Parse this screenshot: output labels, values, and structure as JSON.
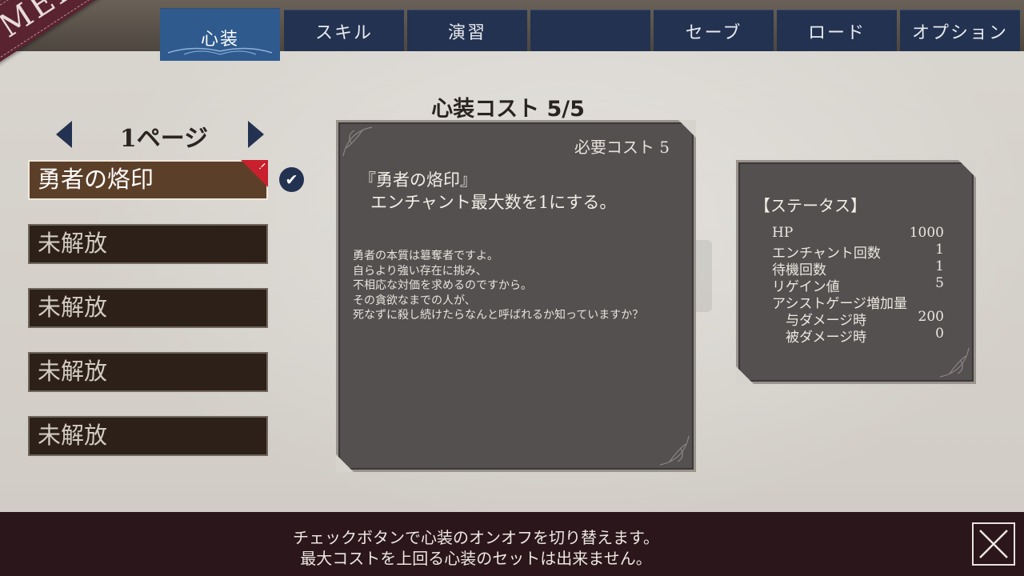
{
  "menu_label": "MENU",
  "tabs": [
    {
      "label": "心装",
      "active": true
    },
    {
      "label": "スキル"
    },
    {
      "label": "演習"
    },
    {
      "label": ""
    },
    {
      "label": "セーブ"
    },
    {
      "label": "ロード"
    },
    {
      "label": "オプション"
    }
  ],
  "page_nav": {
    "label": "1ページ"
  },
  "slots": [
    {
      "label": "勇者の烙印",
      "selected": true,
      "new_mark": "!"
    },
    {
      "label": "未解放"
    },
    {
      "label": "未解放"
    },
    {
      "label": "未解放"
    },
    {
      "label": "未解放"
    }
  ],
  "cost_title": "心装コスト 5/5",
  "description": {
    "required_cost": "必要コスト 5",
    "name": "『勇者の烙印』",
    "effect": "エンチャント最大数を1にする。",
    "flavor": [
      "勇者の本質は簒奪者ですよ。",
      "自らより強い存在に挑み、",
      "不相応な対価を求めるのですから。",
      "その貪欲なまでの人が、",
      "死なずに殺し続けたらなんと呼ばれるか知っていますか？"
    ]
  },
  "status": {
    "title": "【ステータス】",
    "rows": [
      {
        "label": "HP",
        "value": "1000"
      },
      {
        "label": "エンチャント回数",
        "value": "1"
      },
      {
        "label": "待機回数",
        "value": "1"
      },
      {
        "label": "リゲイン値",
        "value": "5"
      },
      {
        "label": "アシストゲージ増加量",
        "value": ""
      },
      {
        "label": "　与ダメージ時",
        "value": "200"
      },
      {
        "label": "　被ダメージ時",
        "value": "0"
      }
    ]
  },
  "hints": {
    "line1": "チェックボタンで心装のオンオフを切り替えます。",
    "line2": "最大コストを上回る心装のセットは出来ません。"
  },
  "colors": {
    "tab_bg": "#233250",
    "tab_active": "#2f5a8e",
    "menu_ribbon": "#5a2330",
    "bottom_bar": "#2b161b",
    "panel_bg": "#545050"
  }
}
